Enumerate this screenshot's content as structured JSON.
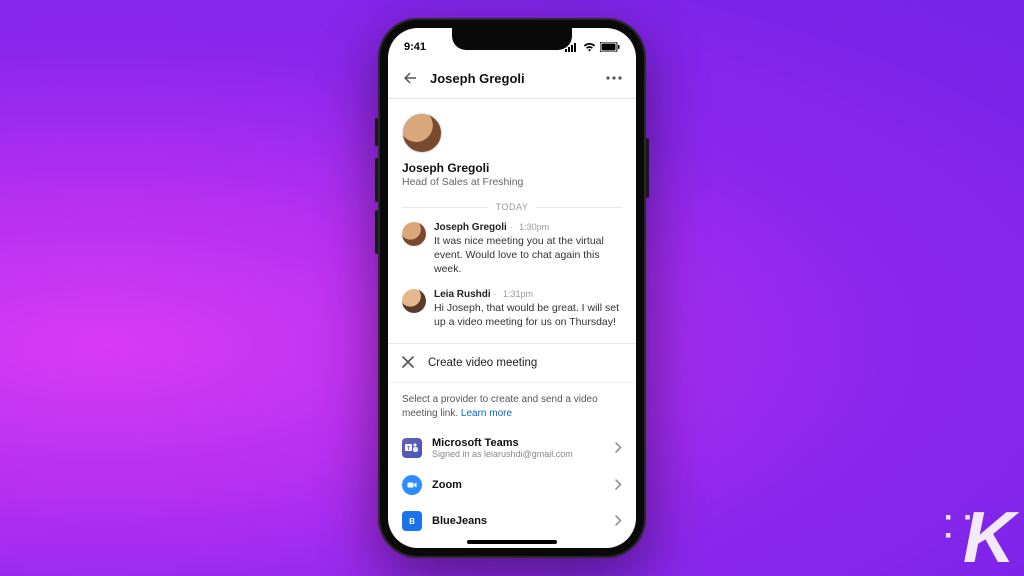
{
  "statusbar": {
    "time": "9:41"
  },
  "header": {
    "title": "Joseph Gregoli"
  },
  "profile": {
    "name": "Joseph Gregoli",
    "headline": "Head of Sales at Freshing"
  },
  "day_separator": "TODAY",
  "messages": [
    {
      "sender": "Joseph Gregoli",
      "timestamp": "1:30pm",
      "body": "It was nice meeting you at the virtual event. Would love to chat again this week."
    },
    {
      "sender": "Leia Rushdi",
      "timestamp": "1:31pm",
      "body": "Hi Joseph, that would be great. I will set up a video meeting for us on Thursday!"
    }
  ],
  "sheet": {
    "title": "Create video meeting",
    "subtitle_prefix": "Select a provider to create and send a video meeting link. ",
    "learn_more": "Learn more"
  },
  "providers": [
    {
      "name": "Microsoft Teams",
      "subtitle": "Signed in as leiarushdi@gmail.com",
      "icon": "teams"
    },
    {
      "name": "Zoom",
      "subtitle": "",
      "icon": "zoom"
    },
    {
      "name": "BlueJeans",
      "subtitle": "",
      "icon": "bj"
    }
  ],
  "watermark": "K"
}
